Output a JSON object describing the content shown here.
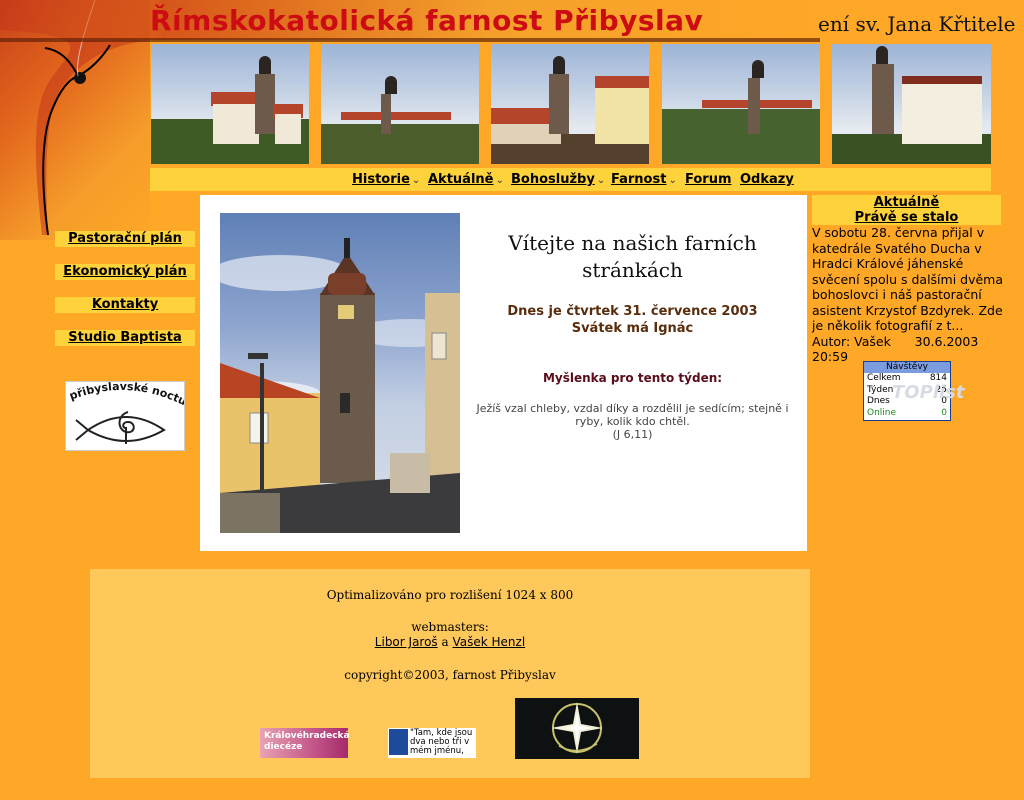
{
  "header": {
    "title": "Římskokatolická farnost Přibyslav",
    "subtitle": "ení sv. Jana Křtitele"
  },
  "nav": {
    "items": [
      {
        "label": "Historie",
        "has_dropdown": true
      },
      {
        "label": "Aktuálně",
        "has_dropdown": true
      },
      {
        "label": "Bohoslužby",
        "has_dropdown": true
      },
      {
        "label": "Farnost",
        "has_dropdown": true
      },
      {
        "label": "Forum",
        "has_dropdown": false
      },
      {
        "label": "Odkazy",
        "has_dropdown": false
      }
    ],
    "arrow_glyph": "⌄"
  },
  "sidebar": {
    "items": [
      {
        "label": "Pastorační plán"
      },
      {
        "label": "Ekonomický plán"
      },
      {
        "label": "Kontakty"
      },
      {
        "label": "Studio Baptista"
      }
    ],
    "logo_text": "přibyslavské nocturno"
  },
  "main": {
    "welcome": "Vítejte na našich farních stránkách",
    "date_line": "Dnes je čtvrtek 31. července 2003",
    "nameday_line": "Svátek má Ignác",
    "thought_heading": "Myšlenka pro tento týden:",
    "thought_text": "Ježíš vzal chleby, vzdal díky a rozdělil je sedícím; stejně i ryby, kolik kdo chtěl.",
    "thought_ref": "(J 6,11)"
  },
  "news": {
    "heading": "Aktuálně",
    "subheading": "Právě se stalo",
    "body": "V sobotu 28. června přijal v katedrále Svatého Ducha v Hradci Králové jáhenské svěcení spolu s dalšími dvěma bohoslovci i náš pastorační asistent Krzystof Bzdyrek. Zde je několik fotografií z t...",
    "author_line": "Autor: Vašek      30.6.2003 20:59"
  },
  "counter": {
    "title": "Návštěvy",
    "watermark": "TOPlist",
    "rows": [
      {
        "label": "Celkem",
        "value": "814"
      },
      {
        "label": "Týden",
        "value": "25"
      },
      {
        "label": "Dnes",
        "value": "0"
      },
      {
        "label": "Online",
        "value": "0"
      }
    ]
  },
  "footer": {
    "optimized": "Optimalizováno pro rozlišení 1024 x 800",
    "webmasters_label": "webmasters:",
    "webmaster1": "Libor Jaroš",
    "and_word": "a",
    "webmaster2": "Vašek Henzl",
    "copyright": "copyright©2003, farnost Přibyslav",
    "logo1_text": "Královéhradecká diecéze",
    "logo2_text": "\"Tam, kde jsou dva nebo tři v mém jménu,"
  },
  "colors": {
    "background": "#ffa726",
    "nav_bar": "#fdd23b",
    "title_red": "#cc0c12",
    "footer_bg": "#ffc85b"
  }
}
